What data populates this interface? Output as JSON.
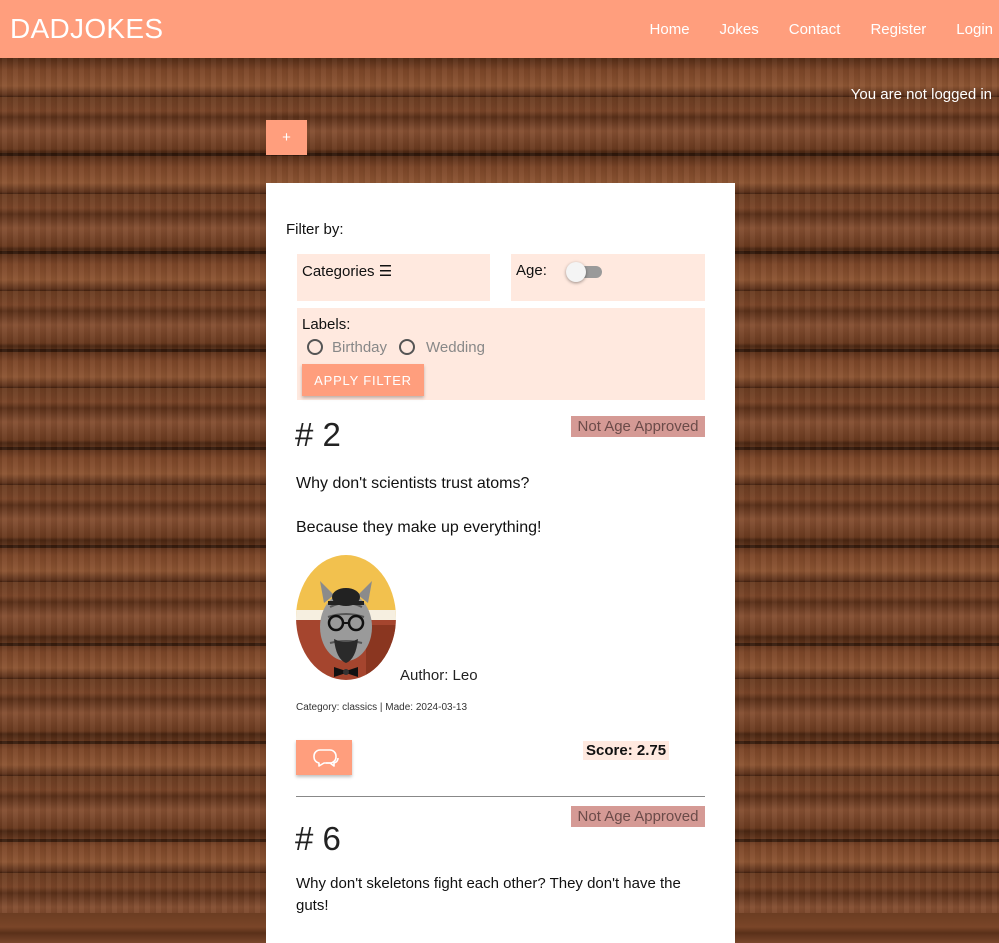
{
  "app": {
    "brand": "DADJOKES"
  },
  "nav": {
    "items": [
      "Home",
      "Jokes",
      "Contact",
      "Register",
      "Login"
    ]
  },
  "status": {
    "login": "You are not logged in"
  },
  "add_button": {
    "label": "+"
  },
  "filter": {
    "title": "Filter by:",
    "categories_label": "Categories ☰",
    "age_label": "Age:",
    "age_toggle_on": false,
    "labels_label": "Labels:",
    "label_options": [
      "Birthday",
      "Wedding"
    ],
    "apply_label": "APPLY FILTER"
  },
  "jokes": [
    {
      "id": "# 2",
      "badge": "Not Age Approved",
      "setup": "Why don't scientists trust atoms?",
      "punchline": "Because they make up everything!",
      "author": "Author: Leo",
      "meta": "Category: classics | Made: 2024-03-13",
      "score": "Score: 2.75"
    },
    {
      "id": "# 6",
      "badge": "Not Age Approved",
      "setup": "Why don't skeletons fight each other? They don't have the guts!"
    }
  ],
  "colors": {
    "accent": "#ff9e7d",
    "pale": "#ffe9df",
    "badge": "#d59a95"
  }
}
